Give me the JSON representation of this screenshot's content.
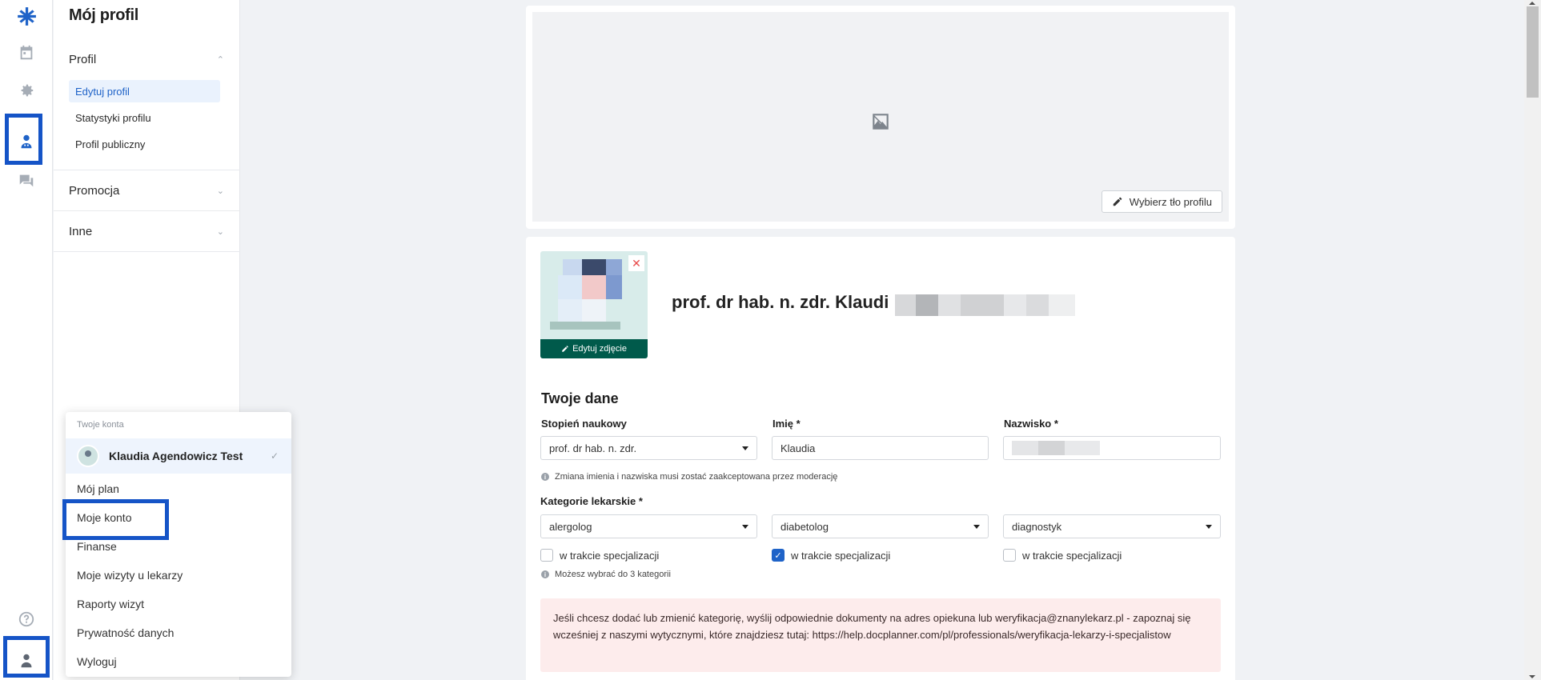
{
  "sidebar": {
    "title": "Mój profil",
    "sections": [
      {
        "label": "Profil",
        "expanded": true,
        "items": [
          "Edytuj profil",
          "Statystyki profilu",
          "Profil publiczny"
        ],
        "active": "Edytuj profil"
      },
      {
        "label": "Promocja",
        "expanded": false
      },
      {
        "label": "Inne",
        "expanded": false
      }
    ]
  },
  "rail": {
    "icons": [
      "logo-icon",
      "calendar-icon",
      "gear-icon",
      "doctor-profile-icon",
      "chat-icon",
      "help-icon",
      "user-account-icon"
    ],
    "highlight_color": "#1554c7"
  },
  "banner": {
    "choose_bg_label": "Wybierz tło profilu"
  },
  "profile": {
    "edit_photo_label": "Edytuj zdjęcie",
    "name_visible": "prof. dr hab. n. zdr. Klaudi"
  },
  "form": {
    "section_title": "Twoje dane",
    "degree_label": "Stopień naukowy",
    "degree_value": "prof. dr hab. n. zdr.",
    "first_name_label": "Imię *",
    "first_name_value": "Klaudia",
    "last_name_label": "Nazwisko *",
    "name_hint": "Zmiana imienia i nazwiska musi zostać zaakceptowana przez moderację",
    "categories_label": "Kategorie lekarskie *",
    "categories": [
      {
        "value": "alergolog",
        "in_training_label": "w trakcie specjalizacji",
        "in_training": false
      },
      {
        "value": "diabetolog",
        "in_training_label": "w trakcie specjalizacji",
        "in_training": true
      },
      {
        "value": "diagnostyk",
        "in_training_label": "w trakcie specjalizacji",
        "in_training": false
      }
    ],
    "categories_hint": "Możesz wybrać do 3 kategorii",
    "alert": "Jeśli chcesz dodać lub zmienić kategorię, wyślij odpowiednie dokumenty na adres opiekuna lub weryfikacja@znanylekarz.pl - zapoznaj się wcześniej z naszymi wytycznymi, które znajdziesz tutaj: https://help.docplanner.com/pl/professionals/weryfikacja-lekarzy-i-specjalistow"
  },
  "account_menu": {
    "title": "Twoje konta",
    "account_name": "Klaudia Agendowicz Test",
    "items": [
      "Mój plan",
      "Moje konto",
      "Finanse",
      "Moje wizyty u lekarzy",
      "Raporty wizyt",
      "Prywatność danych",
      "Wyloguj"
    ]
  }
}
